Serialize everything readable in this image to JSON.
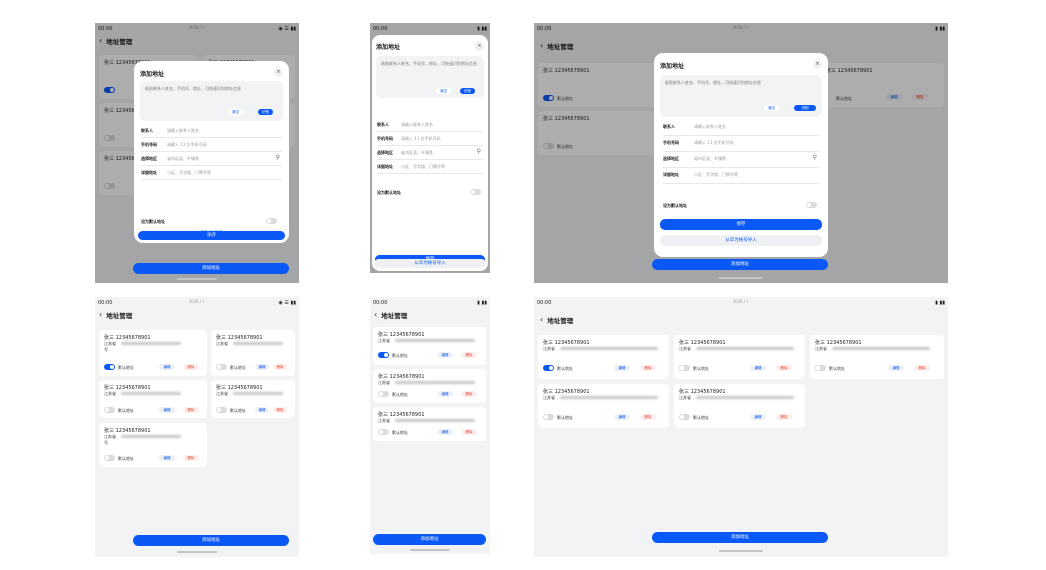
{
  "status": {
    "time": "00:00",
    "center": "9:00 / •",
    "right_wide": "◉ ☰ ▮▮",
    "right_narrow": "▮ ▮▮"
  },
  "header": {
    "title": "地址管理",
    "back": "‹"
  },
  "card": {
    "name": "张三 12345678901",
    "addr_prefix": "江苏省",
    "addr_tail": "号",
    "default": "默认地址",
    "edit": "编辑",
    "delete": "删除"
  },
  "add_button": "添加地址",
  "dialog": {
    "title": "添加地址",
    "close": "×",
    "paste_hint": "粘贴联系人姓名、手机号、地址，可快速识别地址信息",
    "clear": "清空",
    "recognize": "识别",
    "fields": [
      {
        "label": "联系人",
        "placeholder": "请输入联系人姓名"
      },
      {
        "label": "手机号码",
        "placeholder": "请输入 11 位手机号码"
      },
      {
        "label": "选择地区",
        "placeholder": "省市区县、乡镇等"
      },
      {
        "label": "详细地址",
        "placeholder": "小区、写字楼、门牌号等"
      }
    ],
    "set_default": "设为默认地址",
    "save": "保存",
    "import": "从华为帐号导入",
    "pin_icon": "location-pin-icon"
  },
  "colors": {
    "accent": "#0a59f7",
    "danger": "#e84026",
    "bg": "#f1f3f5"
  }
}
